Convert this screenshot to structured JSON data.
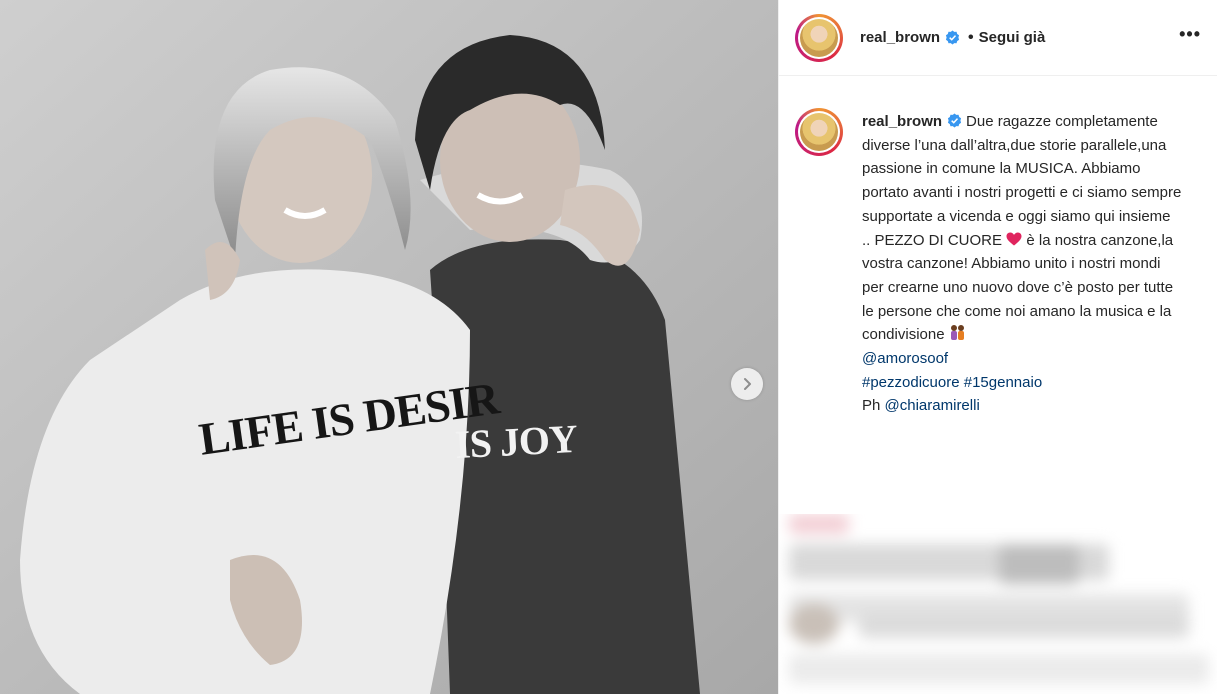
{
  "post": {
    "username": "real_brown",
    "follow_status": "Segui già",
    "dot": "•",
    "more": "•••",
    "caption": {
      "username": "real_brown",
      "text_part1": "Due ragazze completamente diverse l’una dall’altra,due storie parallele,una passione in comune la MUSICA. Abbiamo portato avanti i nostri progetti e ci siamo sempre supportate a vicenda e oggi siamo qui insieme .. PEZZO DI CUORE",
      "text_part2": "è la nostra canzone,la vostra canzone! Abbiamo unito i nostri mondi per crearne uno nuovo dove c’è posto per tutte le persone che come noi amano la musica e la condivisione",
      "mention": "@amorosoof",
      "hashtag1": "#pezzodicuore",
      "hashtag2": "#15gennaio",
      "ph_label": "Ph",
      "ph_mention": "@chiaramirelli"
    },
    "photo_text": {
      "left": "LIFE IS DESIR",
      "right": "IS JOY"
    },
    "icons": {
      "next": "chevron-right-icon",
      "verified": "verified-badge-icon",
      "heart": "red-heart-emoji",
      "people": "two-women-emoji"
    },
    "colors": {
      "verified": "#3897f0",
      "link": "#00376b",
      "heart": "#e0245e"
    }
  }
}
